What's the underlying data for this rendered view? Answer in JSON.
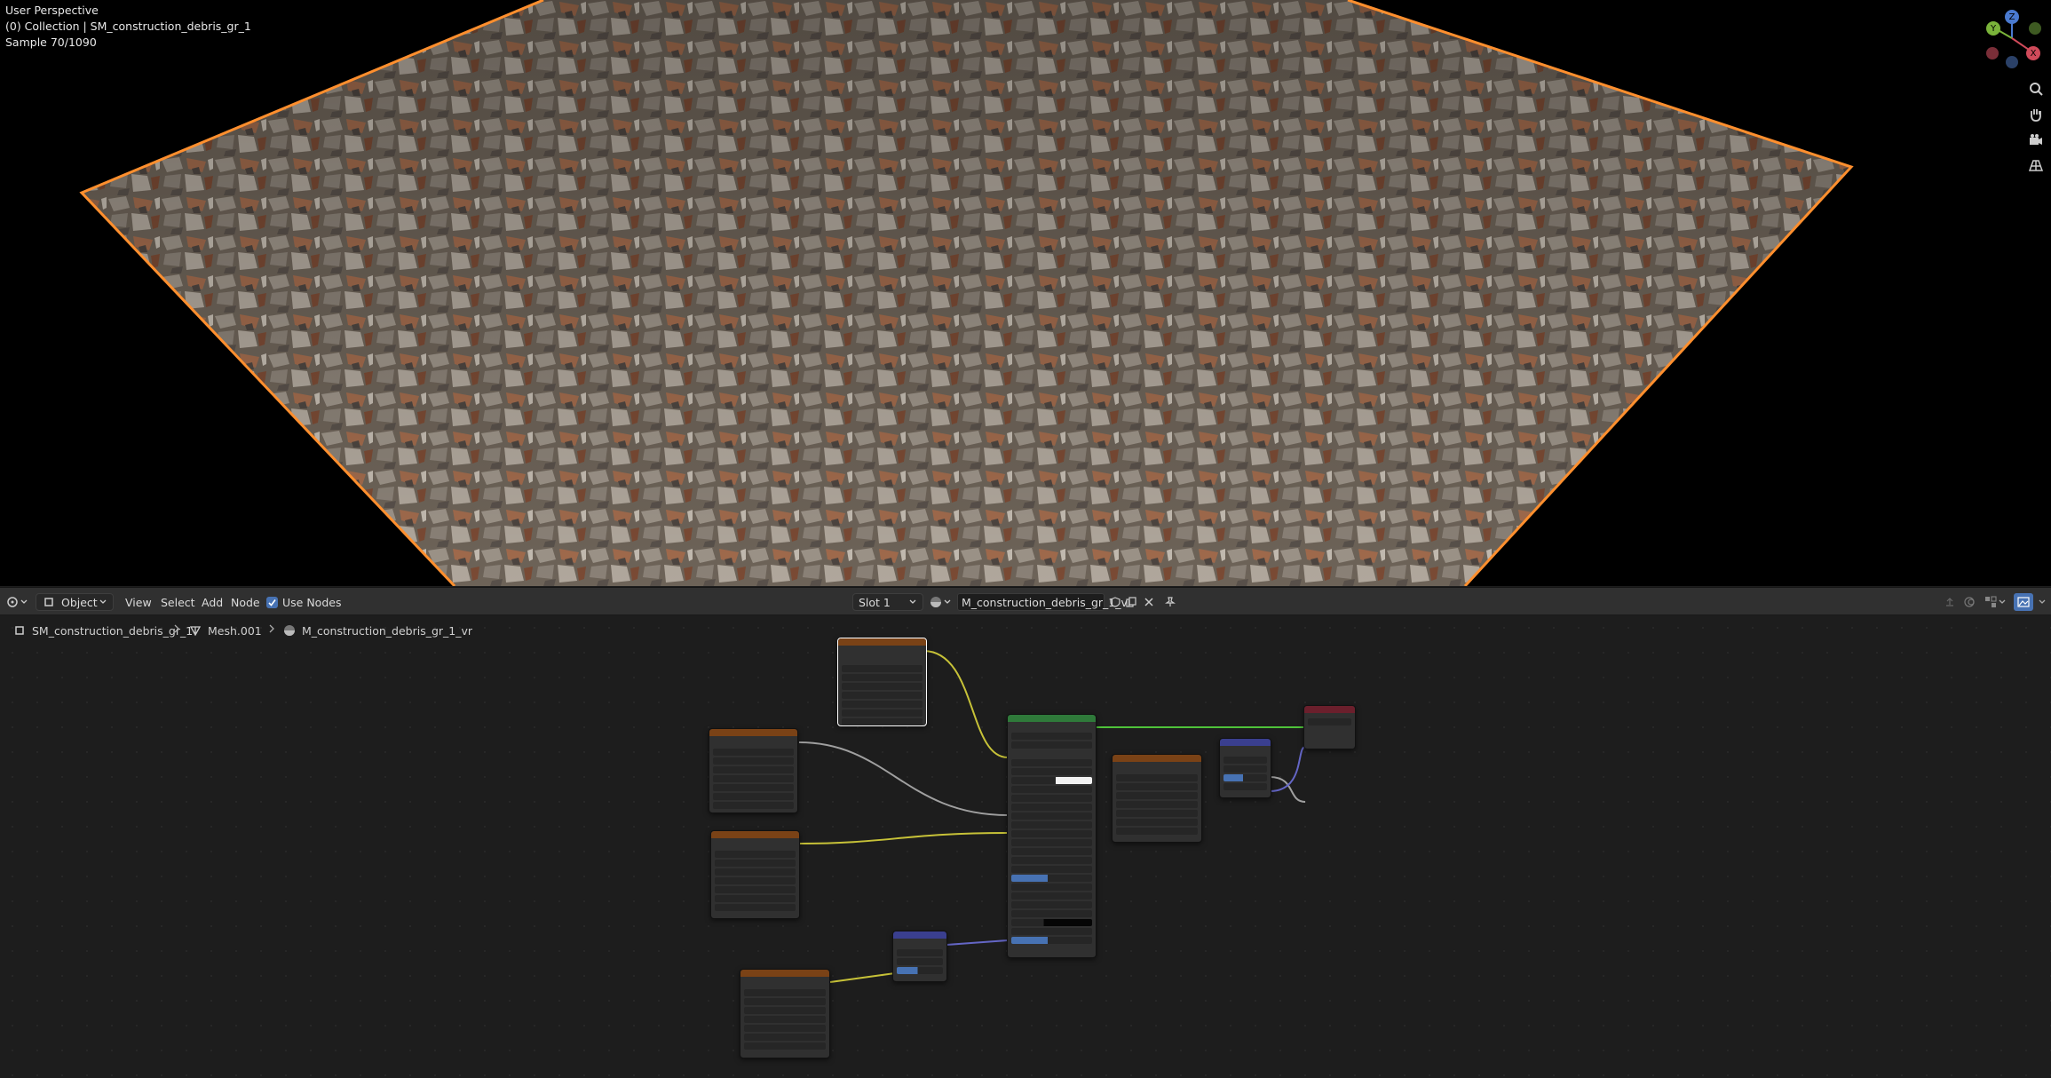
{
  "viewport": {
    "info_lines": [
      "User Perspective",
      "(0) Collection | SM_construction_debris_gr_1",
      "Sample 70/1090"
    ],
    "gizmo_axes": {
      "x": "X",
      "y": "Y",
      "z": "Z"
    },
    "tool_icons": [
      "zoom-icon",
      "hand-pan-icon",
      "camera-icon",
      "grid-icon"
    ]
  },
  "header": {
    "editor_type_icon": "node-editor-icon",
    "mode": "Object",
    "menus": [
      "View",
      "Select",
      "Add",
      "Node"
    ],
    "use_nodes_label": "Use Nodes",
    "use_nodes_checked": true,
    "slot": "Slot 1",
    "material_name": "M_construction_debris_gr_1_vr"
  },
  "breadcrumb": {
    "object": "SM_construction_debris_gr_1",
    "mesh": "Mesh.001",
    "material": "M_construction_debris_gr_1_vr"
  },
  "colors": {
    "image_header": "#7a4216",
    "bsdf_header": "#2f7a3a",
    "output_header": "#6b1f2c",
    "vector_header": "#3a3f8f",
    "link_color": "#c7c238",
    "link_green": "#4fc33a",
    "link_purple": "#6466c6",
    "link_grey": "#a0a0a0",
    "selection": "#ff8f2e"
  }
}
